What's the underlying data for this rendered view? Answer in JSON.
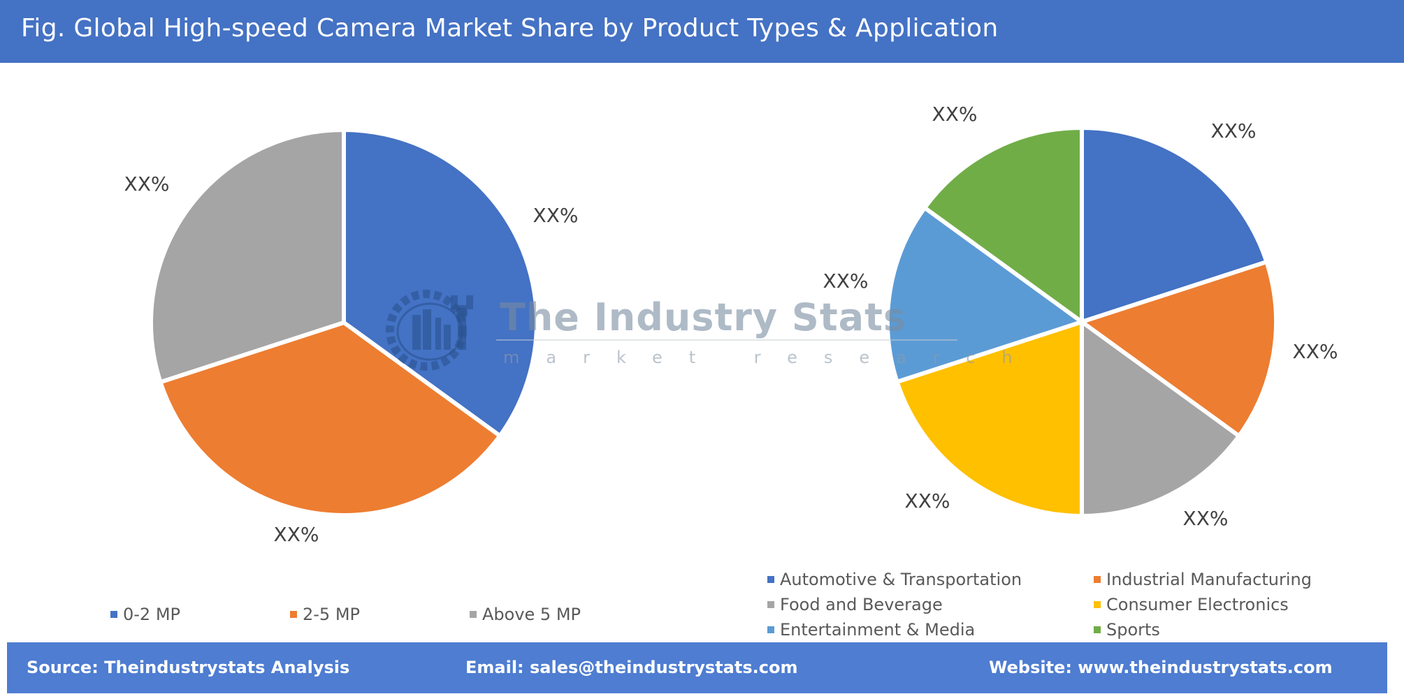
{
  "header": {
    "title": "Fig. Global High-speed Camera Market Share by Product Types & Application"
  },
  "watermark": {
    "title": "The Industry Stats",
    "subtitle": "market research",
    "icon": "gear-wrench-factory-logo-icon"
  },
  "chart_data": [
    {
      "type": "pie",
      "title": "Product Types",
      "categories": [
        "0-2 MP",
        "2-5 MP",
        "Above 5 MP"
      ],
      "values": [
        35,
        35,
        30
      ],
      "data_labels": [
        "XX%",
        "XX%",
        "XX%"
      ],
      "colors": [
        "#4472c4",
        "#ed7d31",
        "#a5a5a5"
      ],
      "start_angle": 0,
      "direction": "clockwise",
      "legend_position": "bottom"
    },
    {
      "type": "pie",
      "title": "Application",
      "categories": [
        "Automotive & Transportation",
        "Industrial Manufacturing",
        "Food and Beverage",
        "Consumer Electronics",
        "Entertainment & Media",
        "Sports"
      ],
      "values": [
        20,
        15,
        15,
        20,
        15,
        15
      ],
      "data_labels": [
        "XX%",
        "XX%",
        "XX%",
        "XX%",
        "XX%",
        "XX%"
      ],
      "colors": [
        "#4472c4",
        "#ed7d31",
        "#a5a5a5",
        "#ffc000",
        "#5b9bd5",
        "#70ad47"
      ],
      "start_angle": 0,
      "direction": "clockwise",
      "legend_position": "bottom"
    }
  ],
  "footer": {
    "source": "Source: Theindustrystats Analysis",
    "email": "Email: sales@theindustrystats.com",
    "website": "Website: www.theindustrystats.com"
  }
}
